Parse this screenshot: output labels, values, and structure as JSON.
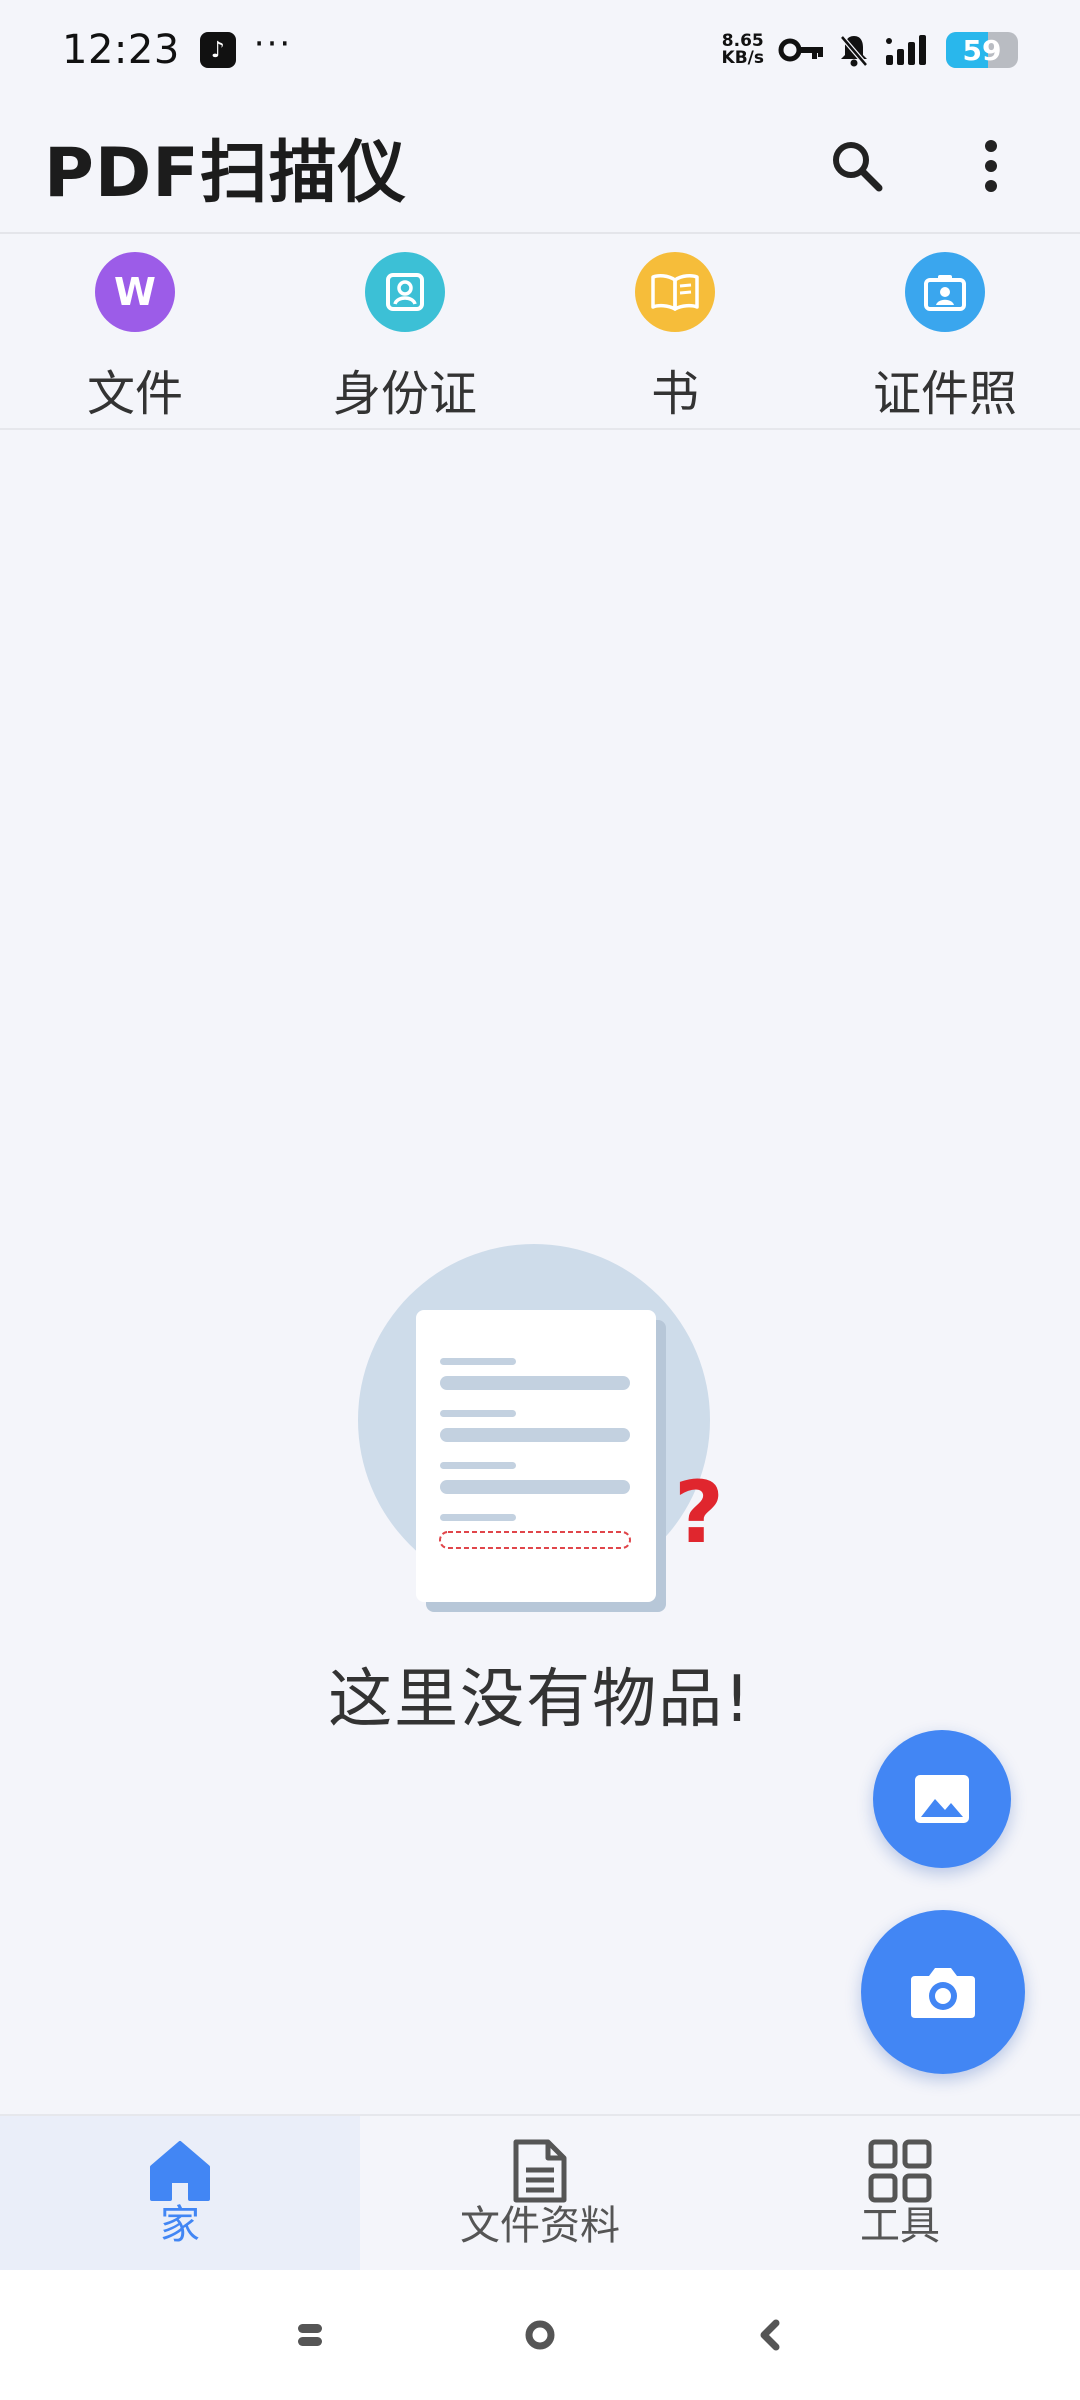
{
  "status_bar": {
    "time": "12:23",
    "overflow": "···",
    "net_speed_value": "8.65",
    "net_speed_unit": "KB/s",
    "battery_level": "59",
    "battery_fraction": 0.59
  },
  "app_bar": {
    "title": "PDF扫描仪",
    "search_icon": "search-icon",
    "menu_icon": "more-vert-icon"
  },
  "categories": [
    {
      "label": "文件",
      "icon": "word-icon",
      "glyph": "W",
      "color": "#9c5ce8"
    },
    {
      "label": "身份证",
      "icon": "id-card-icon",
      "color": "#3cc0d6"
    },
    {
      "label": "书",
      "icon": "book-icon",
      "color": "#f6bd3a"
    },
    {
      "label": "证件照",
      "icon": "id-photo-icon",
      "color": "#3aa6ee"
    }
  ],
  "empty_state": {
    "message": "这里没有物品!",
    "question_mark": "?"
  },
  "fabs": {
    "gallery_icon": "image-icon",
    "camera_icon": "camera-icon",
    "color": "#4286f4"
  },
  "bottom_nav": [
    {
      "label": "家",
      "icon": "home-icon",
      "active": true
    },
    {
      "label": "文件资料",
      "icon": "document-icon",
      "active": false
    },
    {
      "label": "工具",
      "icon": "grid-icon",
      "active": false
    }
  ],
  "colors": {
    "accent": "#4286f4",
    "background": "#f4f5fa"
  }
}
